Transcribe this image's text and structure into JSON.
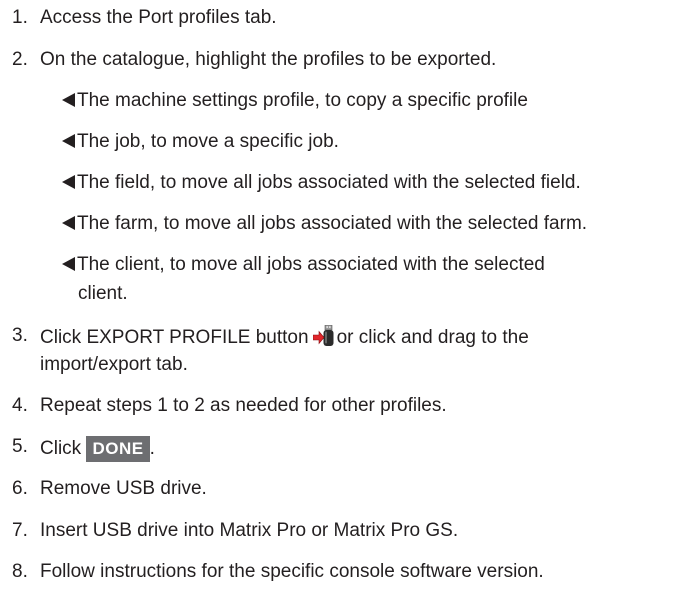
{
  "steps": [
    {
      "num": "1.",
      "text": "Access the Port profiles tab."
    },
    {
      "num": "2.",
      "text": "On the catalogue, highlight the profiles to be exported."
    },
    {
      "num": "3.",
      "text_before": "Click EXPORT PROFILE button",
      "text_after": "or click and drag to the",
      "text_line2": "import/export tab.",
      "icon": "usb-export-icon"
    },
    {
      "num": "4.",
      "text": "Repeat steps 1 to 2 as needed for other profiles."
    },
    {
      "num": "5.",
      "text_before": "Click",
      "button_label": "DONE",
      "text_after": "."
    },
    {
      "num": "6.",
      "text": "Remove USB drive."
    },
    {
      "num": "7.",
      "text": "Insert USB drive into Matrix Pro or Matrix Pro GS."
    },
    {
      "num": "8.",
      "text": "Follow instructions for the specific console software version."
    }
  ],
  "sub_items": [
    {
      "text": "The machine settings profile, to copy a specific profile"
    },
    {
      "text": "The job, to move a specific job."
    },
    {
      "text": "The field, to move all jobs associated with the selected field."
    },
    {
      "text": "The farm, to move all jobs associated with the selected farm."
    },
    {
      "text": "The client, to move all jobs associated with the selected",
      "text_line2": "client."
    }
  ],
  "colors": {
    "text": "#231f20",
    "done_button_bg": "#6d6e71",
    "done_button_text": "#ffffff"
  }
}
